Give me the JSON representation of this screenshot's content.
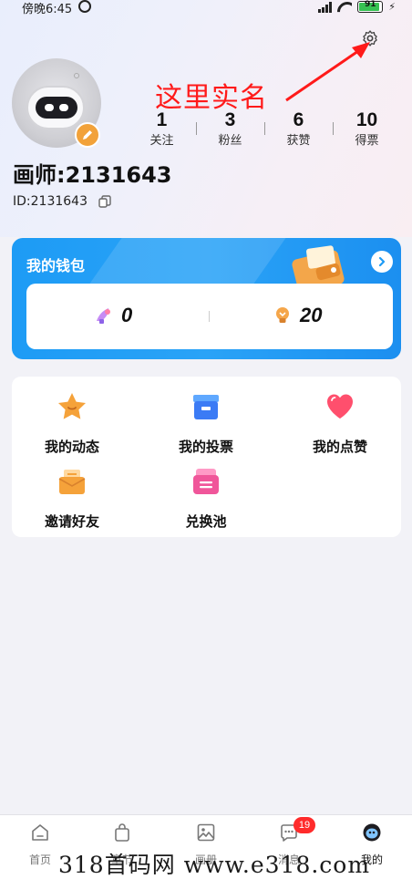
{
  "status_bar": {
    "time": "傍晚6:45",
    "battery": "91"
  },
  "annotation": {
    "text": "这里实名"
  },
  "profile": {
    "name": "画师:2131643",
    "id": "ID:2131643",
    "stats": [
      {
        "value": "1",
        "label": "关注"
      },
      {
        "value": "3",
        "label": "粉丝"
      },
      {
        "value": "6",
        "label": "获赞"
      },
      {
        "value": "10",
        "label": "得票"
      }
    ]
  },
  "wallet": {
    "title": "我的钱包",
    "balances": [
      {
        "value": "0",
        "icon": "brush-coin-icon"
      },
      {
        "value": "20",
        "icon": "bulb-coin-icon"
      }
    ]
  },
  "menu": {
    "items": [
      {
        "label": "我的动态",
        "icon": "star-icon"
      },
      {
        "label": "我的投票",
        "icon": "ballot-box-icon"
      },
      {
        "label": "我的点赞",
        "icon": "heart-icon"
      },
      {
        "label": "邀请好友",
        "icon": "envelope-icon"
      },
      {
        "label": "兑换池",
        "icon": "exchange-icon"
      }
    ]
  },
  "tabs": [
    {
      "label": "首页",
      "icon": "home-icon"
    },
    {
      "label": "章节",
      "icon": "bag-icon"
    },
    {
      "label": "画册",
      "icon": "album-icon"
    },
    {
      "label": "消息",
      "icon": "message-icon",
      "badge": "19"
    },
    {
      "label": "我的",
      "icon": "profile-icon"
    }
  ],
  "watermark": {
    "text": "318首码网 www.e318.com"
  },
  "colors": {
    "accent": "#1d9bf5",
    "annotation": "#ff1a1a",
    "badge": "#ff2b2b"
  }
}
